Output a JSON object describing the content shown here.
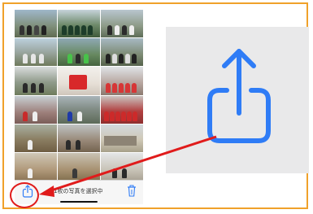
{
  "toolbar": {
    "selection_label": "1枚の写真を選択中",
    "share_icon": "share-icon",
    "trash_icon": "trash-icon"
  },
  "zoom": {
    "icon": "share-icon"
  },
  "colors": {
    "frame": "#f0a12a",
    "accent": "#2f7cf6",
    "annotation": "#e01b1b",
    "zoom_background": "#e9e9ea"
  }
}
